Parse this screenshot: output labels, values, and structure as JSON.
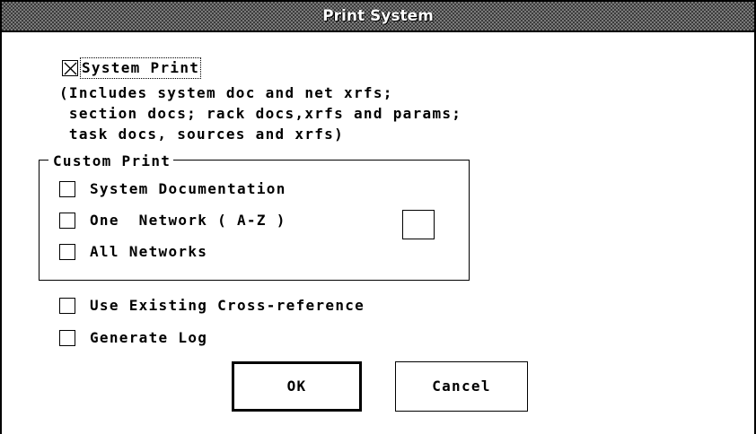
{
  "window": {
    "title": "Print System"
  },
  "system_print": {
    "label": "System Print",
    "checked": true,
    "description_lines": [
      "(Includes system doc and net xrfs;",
      " section docs; rack docs,xrfs and params;",
      " task docs, sources and xrfs)"
    ]
  },
  "custom_print": {
    "legend": "Custom Print",
    "items": [
      {
        "label": "System Documentation",
        "checked": false
      },
      {
        "label": "One  Network ( A-Z )",
        "checked": false,
        "network_value": ""
      },
      {
        "label": "All Networks",
        "checked": false
      }
    ]
  },
  "options": [
    {
      "label": "Use Existing Cross-reference",
      "checked": false
    },
    {
      "label": "Generate Log",
      "checked": false
    }
  ],
  "buttons": {
    "ok": "OK",
    "cancel": "Cancel"
  }
}
